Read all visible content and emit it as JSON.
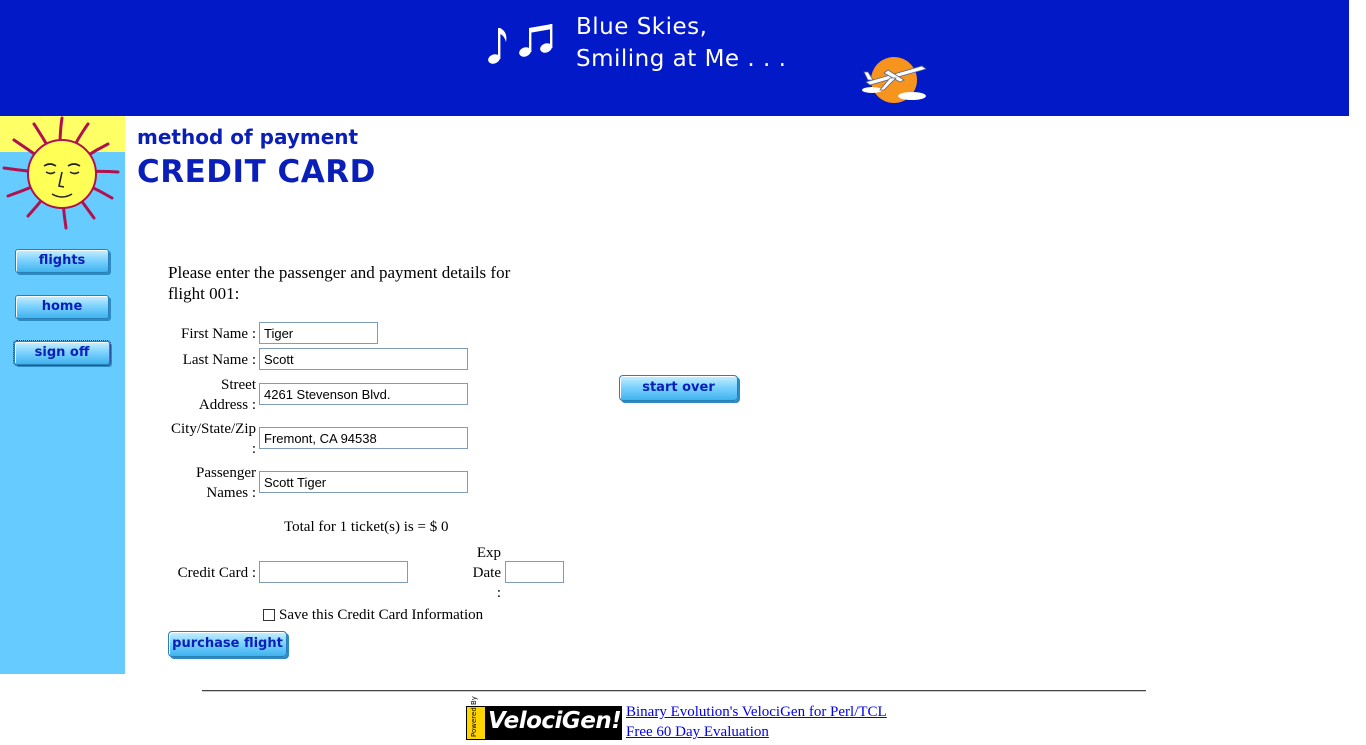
{
  "banner": {
    "line1": "Blue Skies,",
    "line2": "Smiling at Me . . .",
    "background_color": "#0219c8"
  },
  "sidebar": {
    "background_color": "#66ccff",
    "nav": {
      "flights": "flights",
      "home": "home",
      "sign_off": "sign off"
    }
  },
  "page": {
    "subheading": "method of payment",
    "heading": "CREDIT CARD",
    "intro": "Please enter the passenger and payment details for flight 001:"
  },
  "form": {
    "first_name_label": "First Name :",
    "first_name_value": "Tiger",
    "last_name_label": "Last Name :",
    "last_name_value": "Scott",
    "street_label_1": "Street",
    "street_label_2": "Address :",
    "street_value": "4261 Stevenson Blvd.",
    "city_label_1": "City/State/Zip",
    "city_label_2": ":",
    "city_value": "Fremont, CA 94538",
    "passenger_label_1": "Passenger",
    "passenger_label_2": "Names :",
    "passenger_value": "Scott Tiger",
    "total": "Total for 1 ticket(s) is = $ 0",
    "credit_card_label": "Credit Card :",
    "credit_card_value": "",
    "exp_label_1": "Exp",
    "exp_label_2": "Date",
    "exp_label_3": ":",
    "exp_value": "",
    "save_card_label": "Save this Credit Card Information",
    "save_card_checked": false,
    "purchase_button": "purchase flight",
    "start_over_button": "start over"
  },
  "footer": {
    "powered_tag": "Powered By",
    "brand": "VelociGen!",
    "link1": "Binary Evolution's VelociGen for Perl/TCL",
    "link2": "Free 60 Day Evaluation"
  }
}
